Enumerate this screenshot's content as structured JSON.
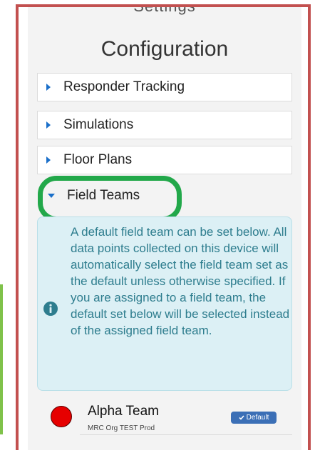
{
  "header": {
    "cut_title": "Settings",
    "title": "Configuration"
  },
  "sections": [
    {
      "label": "Responder Tracking",
      "expanded": false
    },
    {
      "label": "Simulations",
      "expanded": false
    },
    {
      "label": "Floor Plans",
      "expanded": false
    }
  ],
  "field_teams": {
    "label": "Field Teams",
    "expanded": true,
    "info_text": "A default field team can be set below.  All data points collected on this device will automatically select the field team set as the default unless otherwise specified.  If you are assigned to a field team, the default set below will be selected instead of the assigned field team.",
    "teams": [
      {
        "name": "Alpha Team",
        "org": "MRC Org TEST Prod",
        "badge": "Default",
        "color": "#e60000"
      }
    ]
  },
  "colors": {
    "accent": "#1a6fc9",
    "highlight_ring": "#22a84a",
    "frame": "#c2504f",
    "info_bg": "#dcf0f5"
  },
  "icons": {
    "collapsed": "caret-right-icon",
    "expanded": "caret-down-icon",
    "info": "info-circle-icon",
    "check": "check-icon"
  }
}
